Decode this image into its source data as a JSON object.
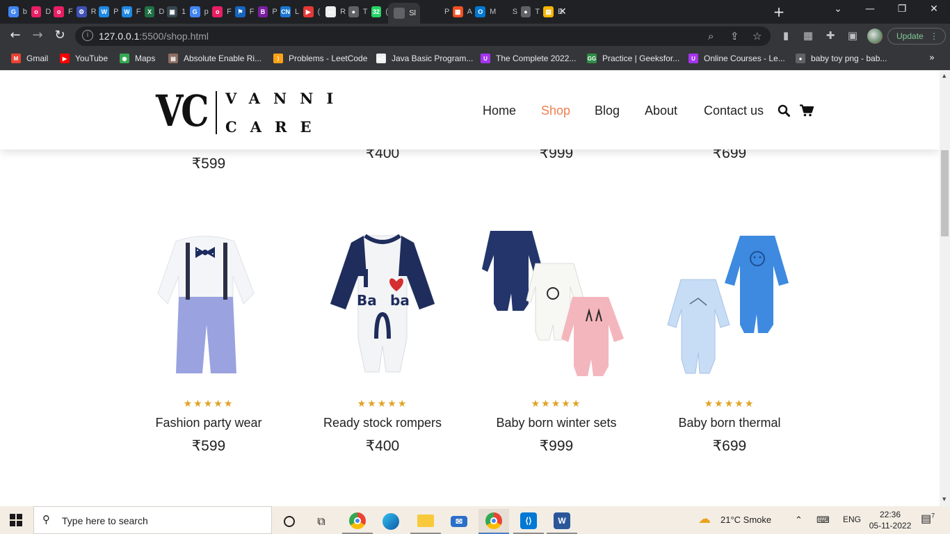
{
  "browser": {
    "tabs": [
      {
        "letter": "b",
        "color": "#4285f4",
        "icon": "G"
      },
      {
        "letter": "D",
        "color": "#e91e63",
        "icon": "o"
      },
      {
        "letter": "F",
        "color": "#e91e63",
        "icon": "o"
      },
      {
        "letter": "R",
        "color": "#3f51b5",
        "icon": "⚙"
      },
      {
        "letter": "P",
        "color": "#1e88e5",
        "icon": "W"
      },
      {
        "letter": "F",
        "color": "#1e88e5",
        "icon": "W"
      },
      {
        "letter": "D",
        "color": "#1e7145",
        "icon": "X"
      },
      {
        "letter": "1",
        "color": "#37474f",
        "icon": "▣"
      },
      {
        "letter": "p",
        "color": "#4285f4",
        "icon": "G"
      },
      {
        "letter": "F",
        "color": "#e91e63",
        "icon": "o"
      },
      {
        "letter": "F",
        "color": "#1565c0",
        "icon": "⚑"
      },
      {
        "letter": "P",
        "color": "#7b1fa2",
        "icon": "B"
      },
      {
        "letter": "L",
        "color": "#1976d2",
        "icon": "CN"
      },
      {
        "letter": "(",
        "color": "#e53935",
        "icon": "▶"
      },
      {
        "letter": "R",
        "color": "#eeeeee",
        "icon": "▭"
      },
      {
        "letter": "T",
        "color": "#5f6368",
        "icon": "●"
      },
      {
        "letter": "(",
        "color": "#25d366",
        "icon": "32"
      },
      {
        "letter": "Sl",
        "color": "#5f6368",
        "icon": "",
        "active": true
      },
      {
        "letter": "P",
        "color": "#202124",
        "icon": ""
      },
      {
        "letter": "A",
        "color": "#f25022",
        "icon": "▦"
      },
      {
        "letter": "M",
        "color": "#0078d4",
        "icon": "O"
      },
      {
        "letter": "S",
        "color": "#202124",
        "icon": ""
      },
      {
        "letter": "T",
        "color": "#5f6368",
        "icon": "●"
      },
      {
        "letter": "E",
        "color": "#f4b400",
        "icon": "▤"
      }
    ],
    "url_host": "127.0.0.1",
    "url_path": ":5500/shop.html",
    "update_label": "Update",
    "bookmarks": [
      {
        "label": "Gmail",
        "color": "#ea4335",
        "icon": "M"
      },
      {
        "label": "YouTube",
        "color": "#ff0000",
        "icon": "▶"
      },
      {
        "label": "Maps",
        "color": "#34a853",
        "icon": "◉"
      },
      {
        "label": "Absolute Enable Ri...",
        "color": "#8d6e63",
        "icon": "▤"
      },
      {
        "label": "Problems - LeetCode",
        "color": "#ffa116",
        "icon": "⟩"
      },
      {
        "label": "Java Basic Program...",
        "color": "#eeeeee",
        "icon": "w3"
      },
      {
        "label": "The Complete 2022...",
        "color": "#a435f0",
        "icon": "U"
      },
      {
        "label": "Practice | Geeksfor...",
        "color": "#2f8d46",
        "icon": "GG"
      },
      {
        "label": "Online Courses - Le...",
        "color": "#a435f0",
        "icon": "U"
      },
      {
        "label": "baby toy png - bab...",
        "color": "#5f6368",
        "icon": "●"
      }
    ]
  },
  "site": {
    "logo_mark": "VC",
    "logo_word1": "VANNI",
    "logo_word2": "CARE",
    "nav": [
      "Home",
      "Shop",
      "Blog",
      "About",
      "Contact us"
    ],
    "active_nav": "Shop",
    "accent": "#f08050",
    "star_color": "#e0a325",
    "prev_row_prices": [
      "₹599",
      "₹400",
      "₹999",
      "₹699"
    ],
    "products": [
      {
        "name": "Fashion party wear",
        "price": "₹599",
        "stars": "★★★★★"
      },
      {
        "name": "Ready stock rompers",
        "price": "₹400",
        "stars": "★★★★★"
      },
      {
        "name": "Baby born winter sets",
        "price": "₹999",
        "stars": "★★★★★"
      },
      {
        "name": "Baby born thermal",
        "price": "₹699",
        "stars": "★★★★★"
      }
    ]
  },
  "taskbar": {
    "search_placeholder": "Type here to search",
    "weather": "21°C  Smoke",
    "language": "ENG",
    "time": "22:36",
    "date": "05-11-2022",
    "notifications": "7"
  }
}
